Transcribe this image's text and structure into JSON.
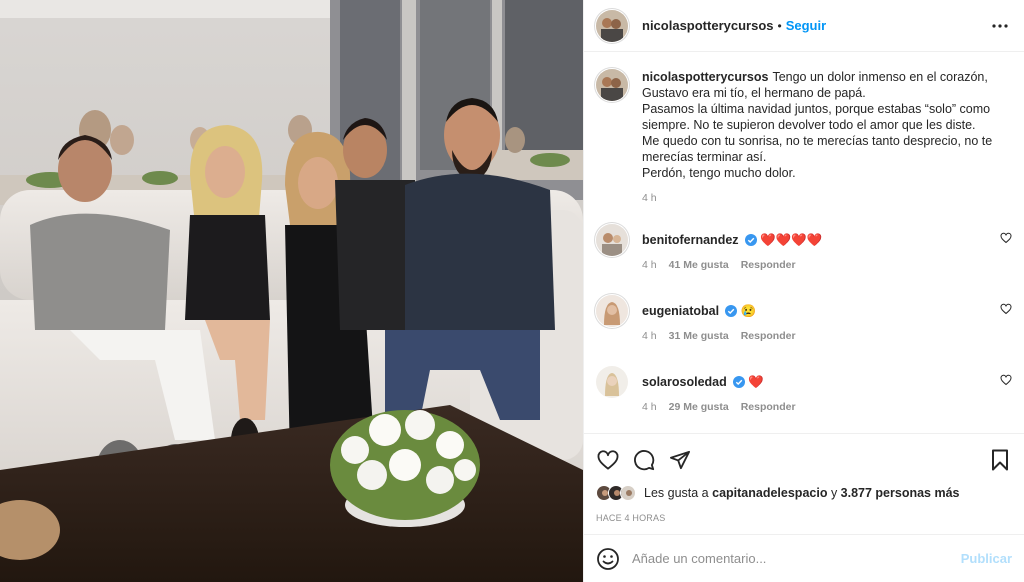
{
  "post_author": {
    "username": "nicolaspotterycursos",
    "follow_label": "Seguir",
    "separator": "•"
  },
  "caption": {
    "username": "nicolaspotterycursos",
    "text": "Tengo un dolor inmenso en el corazón, Gustavo era mi tío, el hermano de papá.\nPasamos la última navidad juntos, porque estabas “solo” como siempre. No te supieron devolver todo el amor que les diste.\nMe quedo con tu sonrisa, no te merecías tanto desprecio, no te merecías terminar así.\nPerdón, tengo mucho dolor.",
    "time": "4 h"
  },
  "comments": [
    {
      "username": "benitofernandez",
      "verified": true,
      "text": "❤️❤️❤️❤️",
      "time": "4 h",
      "likes": "41 Me gusta",
      "reply_label": "Responder"
    },
    {
      "username": "eugeniatobal",
      "verified": true,
      "text": "😢",
      "time": "4 h",
      "likes": "31 Me gusta",
      "reply_label": "Responder"
    },
    {
      "username": "solarosoledad",
      "verified": true,
      "text": "❤️",
      "time": "4 h",
      "likes": "29 Me gusta",
      "reply_label": "Responder"
    }
  ],
  "likes_summary": {
    "prefix": "Les gusta a",
    "user": "capitanadelespacio",
    "middle": "y",
    "others": "3.877 personas más"
  },
  "posted_ago": "HACE 4 HORAS",
  "comment_box": {
    "placeholder": "Añade un comentario...",
    "publish_label": "Publicar"
  },
  "colors": {
    "link_blue": "#0095f6",
    "publish_disabled": "#b2dffc",
    "verified_blue": "#3897f0",
    "heart_red": "#ed4956"
  }
}
